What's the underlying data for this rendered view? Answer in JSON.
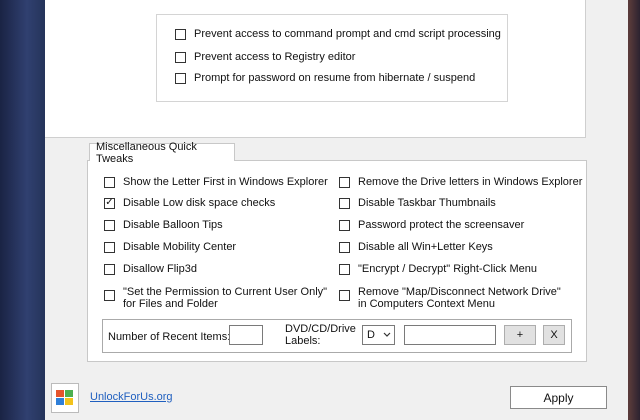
{
  "security_options": [
    {
      "label": "Prevent access to command prompt and cmd script processing",
      "checked": false
    },
    {
      "label": "Prevent access to Registry editor",
      "checked": false
    },
    {
      "label": "Prompt for password on resume from hibernate / suspend",
      "checked": false
    }
  ],
  "misc": {
    "tab_label": "Miscellaneous Quick Tweaks",
    "left": [
      {
        "label": "Show the Letter First in Windows Explorer",
        "checked": false
      },
      {
        "label": "Disable Low disk space checks",
        "checked": true
      },
      {
        "label": "Disable Balloon Tips",
        "checked": false
      },
      {
        "label": "Disable Mobility Center",
        "checked": false
      },
      {
        "label": "Disallow Flip3d",
        "checked": false
      },
      {
        "label_line1": "\"Set the Permission to Current User Only\"",
        "label_line2": "for Files and Folder",
        "checked": false
      }
    ],
    "right": [
      {
        "label": "Remove the Drive letters in Windows Explorer",
        "checked": false
      },
      {
        "label": "Disable Taskbar Thumbnails",
        "checked": false
      },
      {
        "label": "Password protect the screensaver",
        "checked": false
      },
      {
        "label": "Disable all Win+Letter Keys",
        "checked": false
      },
      {
        "label": "\"Encrypt / Decrypt\" Right-Click Menu",
        "checked": false
      },
      {
        "label_line1": "Remove \"Map/Disconnect Network Drive\"",
        "label_line2": "in Computers Context Menu",
        "checked": false
      }
    ],
    "recent_items_label": "Number of Recent Items:",
    "recent_items_value": "",
    "drive_labels_line1": "DVD/CD/Drive",
    "drive_labels_line2": "Labels:",
    "drive_select_value": "D",
    "drive_label_value": "",
    "add_button": "+",
    "remove_button": "X"
  },
  "footer": {
    "link_text": "UnlockForUs.org",
    "apply_label": "Apply"
  },
  "icons": {
    "dropdown": "chevron-down-icon",
    "logo": "app-logo-icon"
  }
}
